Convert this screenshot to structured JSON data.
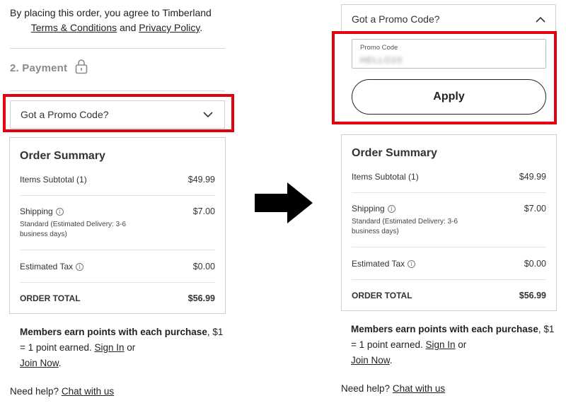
{
  "left": {
    "agree_prefix": "By placing this order, you agree to Timberland",
    "terms_link": "Terms & Conditions",
    "and": "and",
    "privacy_link": "Privacy Policy",
    "period": ".",
    "payment_label": "2. Payment",
    "promo_label": "Got a Promo Code?"
  },
  "right": {
    "promo_label": "Got a Promo Code?",
    "promo_field_label": "Promo Code",
    "promo_field_value": "HELLO10",
    "apply_label": "Apply"
  },
  "summary": {
    "title": "Order Summary",
    "subtotal_label": "Items Subtotal (1)",
    "subtotal_value": "$49.99",
    "shipping_label": "Shipping",
    "shipping_value": "$7.00",
    "shipping_detail": "Standard (Estimated Delivery: 3-6 business days)",
    "tax_label": "Estimated Tax",
    "tax_value": "$0.00",
    "total_label": "ORDER TOTAL",
    "total_value": "$56.99"
  },
  "members": {
    "bold_text": "Members earn points with each purchase",
    "rest_text": ", $1 = 1 point earned.",
    "sign_in": "Sign In",
    "or": "or",
    "join_now": "Join Now",
    "period": "."
  },
  "help": {
    "prefix": "Need help?",
    "chat_link": "Chat with us"
  },
  "colors": {
    "highlight": "#e3000f",
    "muted": "#8a8a8a",
    "border": "#cfcfcf"
  }
}
